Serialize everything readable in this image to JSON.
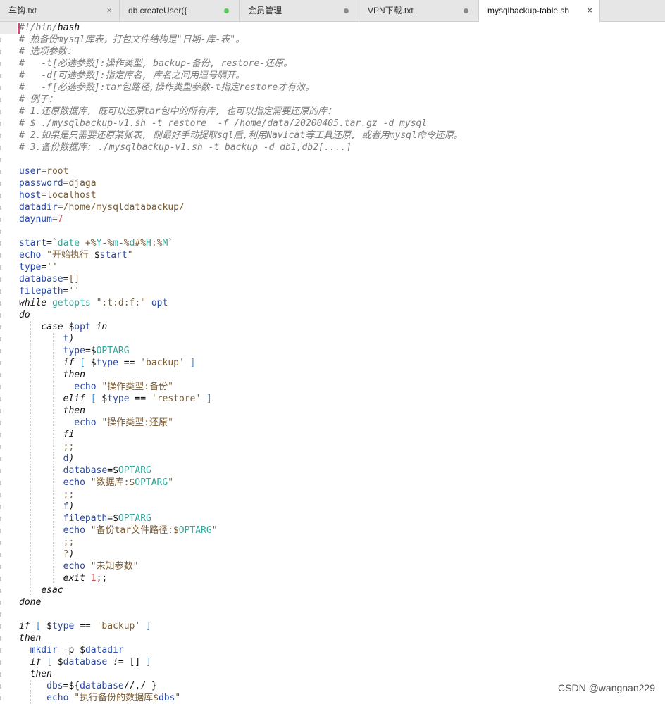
{
  "tabs": [
    {
      "label": "车钩.txt",
      "control": "×",
      "state": "close"
    },
    {
      "label": "db.createUser({",
      "state": "modified-green"
    },
    {
      "label": "会员管理",
      "state": "modified"
    },
    {
      "label": "VPN下载.txt",
      "state": "modified"
    },
    {
      "label": "mysqlbackup-table.sh",
      "control": "×",
      "state": "active"
    }
  ],
  "code_lines": [
    [
      [
        "c",
        "#!/bin/"
      ],
      [
        "k",
        "bash"
      ]
    ],
    [
      [
        "c",
        "# 热备份mysql库表，打包文件结构是\"日期-库-表\"。"
      ]
    ],
    [
      [
        "c",
        "# 选项参数："
      ]
    ],
    [
      [
        "c",
        "#   -t[必选参数]:操作类型, backup-备份, restore-还原。"
      ]
    ],
    [
      [
        "c",
        "#   -d[可选参数]:指定库名, 库名之间用逗号隔开。"
      ]
    ],
    [
      [
        "c",
        "#   -f[必选参数]:tar包路径,操作类型参数-t指定restore才有效。"
      ]
    ],
    [
      [
        "c",
        "# 例子："
      ]
    ],
    [
      [
        "c",
        "# 1.还原数据库, 既可以还原tar包中的所有库, 也可以指定需要还原的库："
      ]
    ],
    [
      [
        "c",
        "# $ ./mysqlbackup-v1.sh -t restore  -f /home/data/20200405.tar.gz -d mysql"
      ]
    ],
    [
      [
        "c",
        "# 2.如果是只需要还原某张表, 则最好手动提取sql后,利用Navicat等工具还原, 或者用mysql命令还原。"
      ]
    ],
    [
      [
        "c",
        "# 3.备份数据库: ./mysqlbackup-v1.sh -t backup -d db1,db2[....]"
      ]
    ],
    [],
    [
      [
        "v",
        "user"
      ],
      [
        "p",
        "="
      ],
      [
        "s",
        "root"
      ]
    ],
    [
      [
        "v",
        "password"
      ],
      [
        "p",
        "="
      ],
      [
        "s",
        "djaga"
      ]
    ],
    [
      [
        "v",
        "host"
      ],
      [
        "p",
        "="
      ],
      [
        "s",
        "localhost"
      ]
    ],
    [
      [
        "v",
        "datadir"
      ],
      [
        "p",
        "="
      ],
      [
        "s",
        "/home/mysqldatabackup/"
      ]
    ],
    [
      [
        "v",
        "daynum"
      ],
      [
        "p",
        "="
      ],
      [
        "n",
        "7"
      ]
    ],
    [],
    [
      [
        "v",
        "start"
      ],
      [
        "p",
        "=`"
      ],
      [
        "b",
        "date"
      ],
      [
        "s",
        " +%"
      ],
      [
        "b",
        "Y"
      ],
      [
        "s",
        "-%"
      ],
      [
        "b",
        "m"
      ],
      [
        "s",
        "-%"
      ],
      [
        "b",
        "d"
      ],
      [
        "s",
        "#%"
      ],
      [
        "b",
        "H"
      ],
      [
        "s",
        ":%"
      ],
      [
        "b",
        "M"
      ],
      [
        "s",
        "`"
      ]
    ],
    [
      [
        "v",
        "echo"
      ],
      [
        "s",
        " \"开始执行 "
      ],
      [
        "p",
        "$"
      ],
      [
        "v",
        "start"
      ],
      [
        "s",
        "\""
      ]
    ],
    [
      [
        "v",
        "type"
      ],
      [
        "p",
        "="
      ],
      [
        "s",
        "''"
      ]
    ],
    [
      [
        "v",
        "database"
      ],
      [
        "p",
        "="
      ],
      [
        "s",
        "[]"
      ]
    ],
    [
      [
        "v",
        "filepath"
      ],
      [
        "p",
        "="
      ],
      [
        "s",
        "''"
      ]
    ],
    [
      [
        "k",
        "while"
      ],
      [
        "p",
        " "
      ],
      [
        "b",
        "getopts"
      ],
      [
        "s",
        " \":t:d:f:\" "
      ],
      [
        "v",
        "opt"
      ]
    ],
    [
      [
        "k",
        "do"
      ]
    ],
    [
      [
        "p",
        "    "
      ],
      [
        "k",
        "case"
      ],
      [
        "p",
        " $"
      ],
      [
        "v",
        "opt"
      ],
      [
        "p",
        " "
      ],
      [
        "k",
        "in"
      ]
    ],
    [
      [
        "p",
        "        "
      ],
      [
        "v",
        "t"
      ],
      [
        "k",
        ")"
      ]
    ],
    [
      [
        "p",
        "        "
      ],
      [
        "v",
        "type"
      ],
      [
        "p",
        "=$"
      ],
      [
        "b",
        "OPTARG"
      ]
    ],
    [
      [
        "p",
        "        "
      ],
      [
        "k",
        "if"
      ],
      [
        "p",
        " "
      ],
      [
        "brk",
        "["
      ],
      [
        "p",
        " $"
      ],
      [
        "v",
        "type"
      ],
      [
        "p",
        " == "
      ],
      [
        "s",
        "'backup'"
      ],
      [
        "p",
        " "
      ],
      [
        "brk",
        "]"
      ]
    ],
    [
      [
        "p",
        "        "
      ],
      [
        "k",
        "then"
      ]
    ],
    [
      [
        "p",
        "          "
      ],
      [
        "v",
        "echo"
      ],
      [
        "s",
        " \"操作类型:备份\""
      ]
    ],
    [
      [
        "p",
        "        "
      ],
      [
        "k",
        "elif"
      ],
      [
        "p",
        " "
      ],
      [
        "brk",
        "["
      ],
      [
        "p",
        " $"
      ],
      [
        "v",
        "type"
      ],
      [
        "p",
        " == "
      ],
      [
        "s",
        "'restore'"
      ],
      [
        "p",
        " "
      ],
      [
        "brk",
        "]"
      ]
    ],
    [
      [
        "p",
        "        "
      ],
      [
        "k",
        "then"
      ]
    ],
    [
      [
        "p",
        "          "
      ],
      [
        "v",
        "echo"
      ],
      [
        "s",
        " \"操作类型:还原\""
      ]
    ],
    [
      [
        "p",
        "        "
      ],
      [
        "k",
        "fi"
      ]
    ],
    [
      [
        "p",
        "        "
      ],
      [
        "s",
        ";;"
      ]
    ],
    [
      [
        "p",
        "        "
      ],
      [
        "v",
        "d"
      ],
      [
        "k",
        ")"
      ]
    ],
    [
      [
        "p",
        "        "
      ],
      [
        "v",
        "database"
      ],
      [
        "p",
        "=$"
      ],
      [
        "b",
        "OPTARG"
      ]
    ],
    [
      [
        "p",
        "        "
      ],
      [
        "v",
        "echo"
      ],
      [
        "s",
        " \"数据库:$"
      ],
      [
        "b",
        "OPTARG"
      ],
      [
        "s",
        "\""
      ]
    ],
    [
      [
        "p",
        "        "
      ],
      [
        "s",
        ";;"
      ]
    ],
    [
      [
        "p",
        "        "
      ],
      [
        "v",
        "f"
      ],
      [
        "k",
        ")"
      ]
    ],
    [
      [
        "p",
        "        "
      ],
      [
        "v",
        "filepath"
      ],
      [
        "p",
        "=$"
      ],
      [
        "b",
        "OPTARG"
      ]
    ],
    [
      [
        "p",
        "        "
      ],
      [
        "v",
        "echo"
      ],
      [
        "s",
        " \"备份tar文件路径:$"
      ],
      [
        "b",
        "OPTARG"
      ],
      [
        "s",
        "\""
      ]
    ],
    [
      [
        "p",
        "        "
      ],
      [
        "s",
        ";;"
      ]
    ],
    [
      [
        "p",
        "        "
      ],
      [
        "s",
        "?"
      ],
      [
        "k",
        ")"
      ]
    ],
    [
      [
        "p",
        "        "
      ],
      [
        "v",
        "echo"
      ],
      [
        "s",
        " \"未知参数\""
      ]
    ],
    [
      [
        "p",
        "        "
      ],
      [
        "k",
        "exit"
      ],
      [
        "p",
        " "
      ],
      [
        "n",
        "1"
      ],
      [
        "p",
        ";;"
      ]
    ],
    [
      [
        "p",
        "    "
      ],
      [
        "k",
        "esac"
      ]
    ],
    [
      [
        "k",
        "done"
      ]
    ],
    [],
    [
      [
        "k",
        "if"
      ],
      [
        "p",
        " "
      ],
      [
        "brk",
        "["
      ],
      [
        "p",
        " $"
      ],
      [
        "v",
        "type"
      ],
      [
        "p",
        " == "
      ],
      [
        "s",
        "'backup'"
      ],
      [
        "p",
        " "
      ],
      [
        "brk",
        "]"
      ]
    ],
    [
      [
        "k",
        "then"
      ]
    ],
    [
      [
        "p",
        "  "
      ],
      [
        "v",
        "mkdir"
      ],
      [
        "p",
        " -p $"
      ],
      [
        "v",
        "datadir"
      ]
    ],
    [
      [
        "p",
        "  "
      ],
      [
        "k",
        "if"
      ],
      [
        "p",
        " "
      ],
      [
        "brk",
        "["
      ],
      [
        "p",
        " $"
      ],
      [
        "v",
        "database"
      ],
      [
        "p",
        " "
      ],
      [
        "k",
        "!="
      ],
      [
        "p",
        " [] "
      ],
      [
        "brk",
        "]"
      ]
    ],
    [
      [
        "p",
        "  "
      ],
      [
        "k",
        "then"
      ]
    ],
    [
      [
        "p",
        "     "
      ],
      [
        "v",
        "dbs"
      ],
      [
        "p",
        "=${"
      ],
      [
        "v",
        "database"
      ],
      [
        "p",
        "//,/ }"
      ]
    ],
    [
      [
        "p",
        "     "
      ],
      [
        "v",
        "echo"
      ],
      [
        "s",
        " \"执行备份的数据库$"
      ],
      [
        "v",
        "dbs"
      ],
      [
        "s",
        "\""
      ]
    ]
  ],
  "watermark": "CSDN @wangnan229"
}
